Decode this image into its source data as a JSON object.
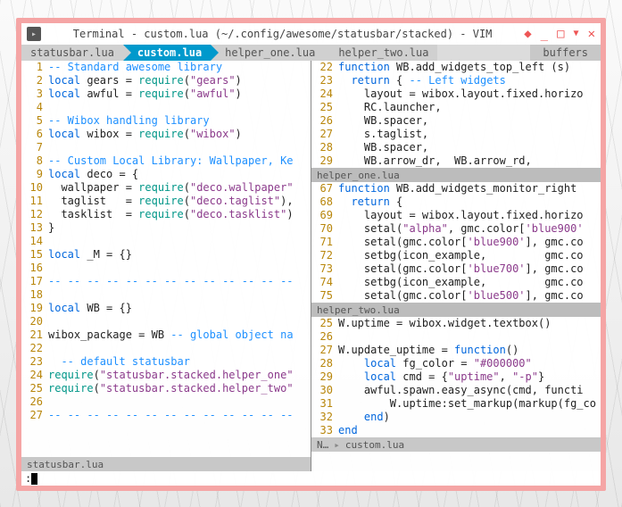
{
  "window": {
    "title": "Terminal - custom.lua (~/.config/awesome/statusbar/stacked) - VIM"
  },
  "win_icons": [
    "pin",
    "min",
    "max",
    "down",
    "close"
  ],
  "tabs": {
    "items": [
      {
        "label": "statusbar.lua",
        "active": false
      },
      {
        "label": "custom.lua",
        "active": true
      },
      {
        "label": "helper_one.lua",
        "active": false
      },
      {
        "label": "helper_two.lua",
        "active": false
      }
    ],
    "right": "buffers"
  },
  "left_pane": {
    "status": "statusbar.lua",
    "lines": [
      {
        "n": 1,
        "t": "comment",
        "s": "-- Standard awesome library"
      },
      {
        "n": 2,
        "t": "req",
        "s": "local gears = require(\"gears\")"
      },
      {
        "n": 3,
        "t": "req",
        "s": "local awful = require(\"awful\")"
      },
      {
        "n": 4,
        "t": "blank",
        "s": ""
      },
      {
        "n": 5,
        "t": "comment",
        "s": "-- Wibox handling library"
      },
      {
        "n": 6,
        "t": "req",
        "s": "local wibox = require(\"wibox\")"
      },
      {
        "n": 7,
        "t": "blank",
        "s": ""
      },
      {
        "n": 8,
        "t": "comment",
        "s": "-- Custom Local Library: Wallpaper, Ke"
      },
      {
        "n": 9,
        "t": "plain",
        "s": "local deco = {"
      },
      {
        "n": 10,
        "t": "req2",
        "s": "  wallpaper = require(\"deco.wallpaper\""
      },
      {
        "n": 11,
        "t": "req2",
        "s": "  taglist   = require(\"deco.taglist\"),"
      },
      {
        "n": 12,
        "t": "req2",
        "s": "  tasklist  = require(\"deco.tasklist\")"
      },
      {
        "n": 13,
        "t": "plain",
        "s": "}"
      },
      {
        "n": 14,
        "t": "blank",
        "s": ""
      },
      {
        "n": 15,
        "t": "plain",
        "s": "local _M = {}"
      },
      {
        "n": 16,
        "t": "blank",
        "s": ""
      },
      {
        "n": 17,
        "t": "comment",
        "s": "-- -- -- -- -- -- -- -- -- -- -- -- --"
      },
      {
        "n": 18,
        "t": "blank",
        "s": ""
      },
      {
        "n": 19,
        "t": "plain",
        "s": "local WB = {}"
      },
      {
        "n": 20,
        "t": "blank",
        "s": ""
      },
      {
        "n": 21,
        "t": "mixed",
        "s": "wibox_package = WB -- global object na"
      },
      {
        "n": 22,
        "t": "blank",
        "s": ""
      },
      {
        "n": 23,
        "t": "comment",
        "s": "  -- default statusbar"
      },
      {
        "n": 24,
        "t": "req3",
        "s": "require(\"statusbar.stacked.helper_one\""
      },
      {
        "n": 25,
        "t": "req3",
        "s": "require(\"statusbar.stacked.helper_two\""
      },
      {
        "n": 26,
        "t": "blank",
        "s": ""
      },
      {
        "n": 27,
        "t": "comment",
        "s": "-- -- -- -- -- -- -- -- -- -- -- -- --"
      }
    ]
  },
  "right_sections": [
    {
      "header": null,
      "lines": [
        {
          "n": 22,
          "s": "function WB.add_widgets_top_left (s)"
        },
        {
          "n": 23,
          "s": "  return { -- Left widgets"
        },
        {
          "n": 24,
          "s": "    layout = wibox.layout.fixed.horizo"
        },
        {
          "n": 25,
          "s": "    RC.launcher,"
        },
        {
          "n": 26,
          "s": "    WB.spacer,"
        },
        {
          "n": 27,
          "s": "    s.taglist,"
        },
        {
          "n": 28,
          "s": "    WB.spacer,"
        },
        {
          "n": 29,
          "s": "    WB.arrow_dr,  WB.arrow_rd,"
        }
      ]
    },
    {
      "header": "helper_one.lua",
      "lines": [
        {
          "n": 67,
          "s": "function WB.add_widgets_monitor_right"
        },
        {
          "n": 68,
          "s": "  return {"
        },
        {
          "n": 69,
          "s": "    layout = wibox.layout.fixed.horizo"
        },
        {
          "n": 70,
          "s": "    setal(\"alpha\", gmc.color['blue900'"
        },
        {
          "n": 71,
          "s": "    setal(gmc.color['blue900'], gmc.co"
        },
        {
          "n": 72,
          "s": "    setbg(icon_example,         gmc.co"
        },
        {
          "n": 73,
          "s": "    setal(gmc.color['blue700'], gmc.co"
        },
        {
          "n": 74,
          "s": "    setbg(icon_example,         gmc.co"
        },
        {
          "n": 75,
          "s": "    setal(gmc.color['blue500'], gmc.co"
        }
      ]
    },
    {
      "header": "helper_two.lua",
      "lines": [
        {
          "n": 25,
          "s": "W.uptime = wibox.widget.textbox()"
        },
        {
          "n": 26,
          "s": ""
        },
        {
          "n": 27,
          "s": "W.update_uptime = function()"
        },
        {
          "n": 28,
          "s": "    local fg_color = \"#000000\""
        },
        {
          "n": 29,
          "s": "    local cmd = {\"uptime\", \"-p\"}"
        },
        {
          "n": 30,
          "s": "    awful.spawn.easy_async(cmd, functi"
        },
        {
          "n": 31,
          "s": "        W.uptime:set_markup(markup(fg_co"
        },
        {
          "n": 32,
          "s": "    end)"
        },
        {
          "n": 33,
          "s": "end"
        }
      ]
    }
  ],
  "right_status": {
    "left": "N…",
    "right": "custom.lua"
  },
  "cmdline": ":"
}
